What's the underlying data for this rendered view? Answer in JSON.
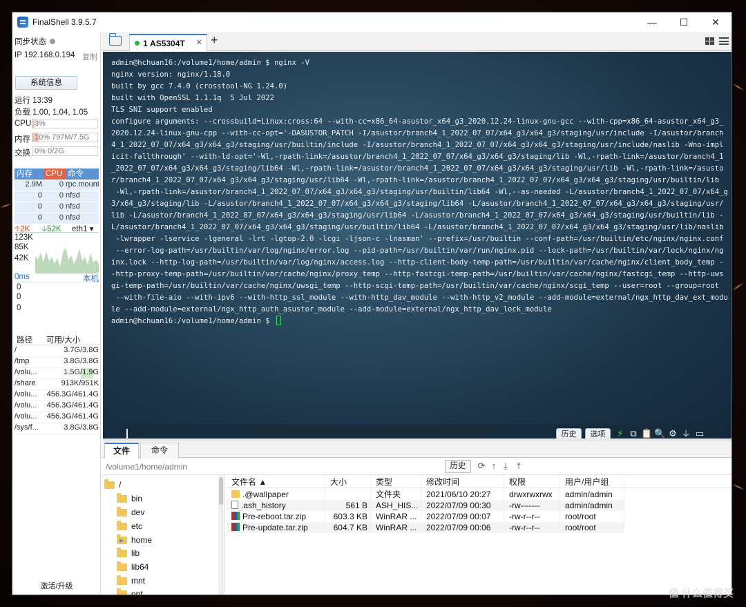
{
  "window": {
    "title": "FinalShell 3.9.5.7",
    "controls": [
      "—",
      "☐",
      "✕"
    ]
  },
  "sidebar": {
    "sync_label": "同步状态",
    "ip": "IP 192.168.0.194",
    "copy_label": "复制",
    "sysinfo_button": "系统信息",
    "uptime": "运行 13:39",
    "load": "负载 1.00, 1.04, 1.05",
    "cpu": {
      "label": "CPU",
      "text": "3%",
      "percent": 3
    },
    "mem": {
      "label": "内存",
      "text": "10%  797M/7.5G",
      "percent": 10
    },
    "swap": {
      "label": "交换",
      "text": "0%     0/2G",
      "percent": 0
    },
    "proc_headers": [
      "内存",
      "CPU",
      "命令"
    ],
    "processes": [
      {
        "mem": "2.9M",
        "cpu": "0",
        "cmd": "rpc.mountd"
      },
      {
        "mem": "0",
        "cpu": "0",
        "cmd": "nfsd"
      },
      {
        "mem": "0",
        "cpu": "0",
        "cmd": "nfsd"
      },
      {
        "mem": "0",
        "cpu": "0",
        "cmd": "nfsd"
      }
    ],
    "net": {
      "up": "2K",
      "down": "52K",
      "iface": "eth1",
      "scale": [
        "123K",
        "85K",
        "42K"
      ]
    },
    "ping": {
      "label": "0ms",
      "host": "本机",
      "values": [
        "0",
        "0",
        "0"
      ]
    },
    "disk_headers": [
      "路径",
      "可用/大小"
    ],
    "disks": [
      {
        "path": "/",
        "value": "3.7G/3.8G"
      },
      {
        "path": "/tmp",
        "value": "3.8G/3.8G"
      },
      {
        "path": "/volu...",
        "value": "1.5G/1.9G"
      },
      {
        "path": "/share",
        "value": "913K/951K"
      },
      {
        "path": "/volu...",
        "value": "456.3G/461.4G"
      },
      {
        "path": "/volu...",
        "value": "456.3G/461.4G"
      },
      {
        "path": "/volu...",
        "value": "456.3G/461.4G"
      },
      {
        "path": "/sys/f...",
        "value": "3.8G/3.8G"
      }
    ],
    "upgrade_label": "激活/升级"
  },
  "tabs": {
    "session": {
      "index": "1",
      "name": "AS5304T"
    },
    "add": "+"
  },
  "terminal": {
    "lines": [
      "admin@hchuan16:/volume1/home/admin $ nginx -V",
      "nginx version: nginx/1.18.0",
      "built by gcc 7.4.0 (crosstool-NG 1.24.0)",
      "built with OpenSSL 1.1.1q  5 Jul 2022",
      "TLS SNI support enabled",
      "configure arguments: --crossbuild=Linux:cross:64 --with-cc=x86_64-asustor_x64_g3_2020.12.24-linux-gnu-gcc --with-cpp=x86_64-asustor_x64_g3_",
      "2020.12.24-linux-gnu-cpp --with-cc-opt='-DASUSTOR_PATCH -I/asustor/branch4_1_2022_07_07/x64_g3/x64_g3/staging/usr/include -I/asustor/branch",
      "4_1_2022_07_07/x64_g3/x64_g3/staging/usr/builtin/include -I/asustor/branch4_1_2022_07_07/x64_g3/x64_g3/staging/usr/include/naslib -Wno-impl",
      "icit-fallthrough' --with-ld-opt='-Wl,-rpath-link=/asustor/branch4_1_2022_07_07/x64_g3/x64_g3/staging/lib -Wl,-rpath-link=/asustor/branch4_1",
      "_2022_07_07/x64_g3/x64_g3/staging/lib64 -Wl,-rpath-link=/asustor/branch4_1_2022_07_07/x64_g3/x64_g3/staging/usr/lib -Wl,-rpath-link=/asusto",
      "r/branch4_1_2022_07_07/x64_g3/x64_g3/staging/usr/lib64 -Wl,-rpath-link=/asustor/branch4_1_2022_07_07/x64_g3/x64_g3/staging/usr/builtin/lib",
      " -Wl,-rpath-link=/asustor/branch4_1_2022_07_07/x64_g3/x64_g3/staging/usr/builtin/lib64 -Wl,--as-needed -L/asustor/branch4_1_2022_07_07/x64_g",
      "3/x64_g3/staging/lib -L/asustor/branch4_1_2022_07_07/x64_g3/x64_g3/staging/lib64 -L/asustor/branch4_1_2022_07_07/x64_g3/x64_g3/staging/usr/",
      "lib -L/asustor/branch4_1_2022_07_07/x64_g3/x64_g3/staging/usr/lib64 -L/asustor/branch4_1_2022_07_07/x64_g3/x64_g3/staging/usr/builtin/lib -",
      "L/asustor/branch4_1_2022_07_07/x64_g3/x64_g3/staging/usr/builtin/lib64 -L/asustor/branch4_1_2022_07_07/x64_g3/x64_g3/staging/usr/lib/naslib",
      " -lwrapper -lservice -lgeneral -lrt -lgtop-2.0 -lcgi -ljson-c -lnasman' --prefix=/usr/builtin --conf-path=/usr/builtin/etc/nginx/nginx.conf",
      " --error-log-path=/usr/builtin/var/log/nginx/error.log --pid-path=/usr/builtin/var/run/nginx.pid --lock-path=/usr/builtin/var/lock/nginx/ng",
      "inx.lock --http-log-path=/usr/builtin/var/log/nginx/access.log --http-client-body-temp-path=/usr/builtin/var/cache/nginx/client_body_temp -",
      "-http-proxy-temp-path=/usr/builtin/var/cache/nginx/proxy_temp --http-fastcgi-temp-path=/usr/builtin/var/cache/nginx/fastcgi_temp --http-uws",
      "gi-temp-path=/usr/builtin/var/cache/nginx/uwsgi_temp --http-scgi-temp-path=/usr/builtin/var/cache/nginx/scgi_temp --user=root --group=root",
      " --with-file-aio --with-ipv6 --with-http_ssl_module --with-http_dav_module --with-http_v2_module --add-module=external/ngx_http_dav_ext_modu",
      "le --add-module=external/ngx_http_auth_asustor_module --add-module=external/ngx_http_dav_lock_module"
    ],
    "prompt": "admin@hchuan16:/volume1/home/admin $ ",
    "history_button": "历史",
    "options_button": "选项"
  },
  "file_manager": {
    "tabs": [
      "文件",
      "命令"
    ],
    "path": "/volume1/home/admin",
    "history_button": "历史",
    "tree": [
      {
        "name": "/",
        "level": 0,
        "link": false
      },
      {
        "name": "bin",
        "level": 1,
        "link": false
      },
      {
        "name": "dev",
        "level": 1,
        "link": false
      },
      {
        "name": "etc",
        "level": 1,
        "link": false
      },
      {
        "name": "home",
        "level": 1,
        "link": true
      },
      {
        "name": "lib",
        "level": 1,
        "link": false
      },
      {
        "name": "lib64",
        "level": 1,
        "link": false
      },
      {
        "name": "mnt",
        "level": 1,
        "link": false
      },
      {
        "name": "opt",
        "level": 1,
        "link": false
      }
    ],
    "columns": [
      "文件名 ▲",
      "大小",
      "类型",
      "修改时间",
      "权限",
      "用户/用户组"
    ],
    "files": [
      {
        "name": ".@wallpaper",
        "icon": "folder",
        "size": "",
        "type": "文件夹",
        "mtime": "2021/06/10 20:27",
        "perm": "drwxrwxrwx",
        "owner": "admin/admin"
      },
      {
        "name": ".ash_history",
        "icon": "doc",
        "size": "561 B",
        "type": "ASH_HIS...",
        "mtime": "2022/07/09 00:30",
        "perm": "-rw-------",
        "owner": "admin/admin"
      },
      {
        "name": "Pre-reboot.tar.zip",
        "icon": "rar",
        "size": "603.3 KB",
        "type": "WinRAR ...",
        "mtime": "2022/07/09 00:07",
        "perm": "-rw-r--r--",
        "owner": "root/root"
      },
      {
        "name": "Pre-update.tar.zip",
        "icon": "rar",
        "size": "604.7 KB",
        "type": "WinRAR ...",
        "mtime": "2022/07/09 00:06",
        "perm": "-rw-r--r--",
        "owner": "root/root"
      }
    ]
  },
  "watermark": "值 什么值得买"
}
